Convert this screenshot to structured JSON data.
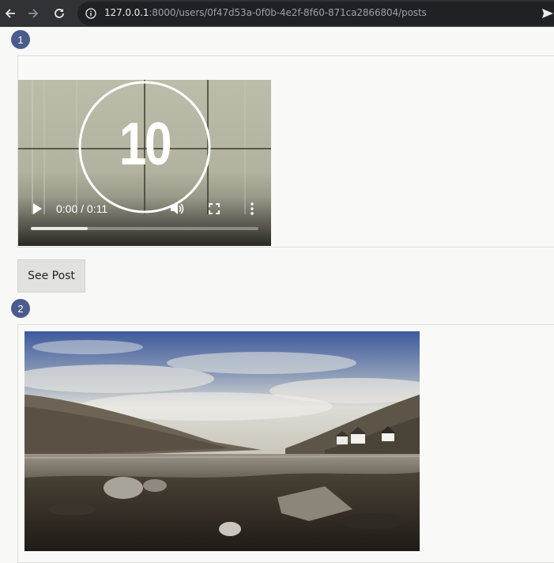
{
  "browser": {
    "url_host": "127.0.0.1",
    "url_path": ":8000/users/0f47d53a-0f0b-4e2f-8f60-871ca2866804/posts"
  },
  "posts": [
    {
      "number": "1",
      "media_type": "video",
      "video": {
        "countdown": "10",
        "time_display": "0:00 / 0:11",
        "progress": 0.25
      },
      "see_post_label": "See Post"
    },
    {
      "number": "2",
      "media_type": "image"
    }
  ]
}
